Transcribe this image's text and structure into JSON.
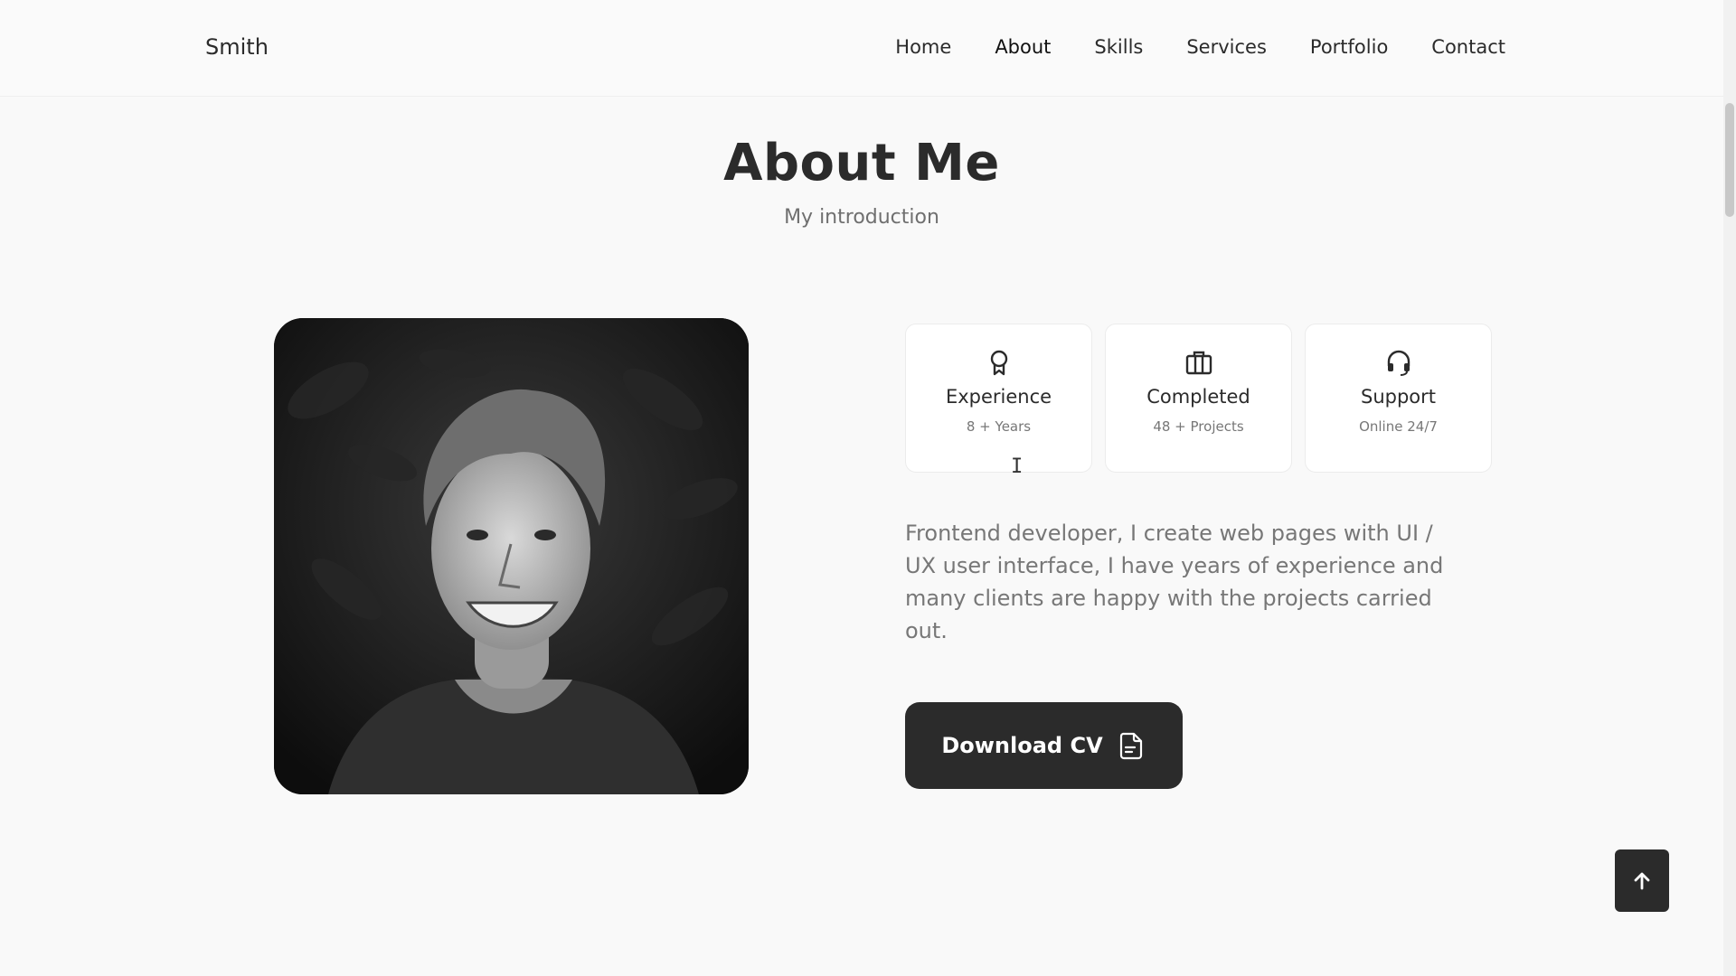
{
  "header": {
    "logo": "Smith",
    "nav": [
      "Home",
      "About",
      "Skills",
      "Services",
      "Portfolio",
      "Contact"
    ],
    "active_nav": "About"
  },
  "section": {
    "title": "About Me",
    "subtitle": "My introduction"
  },
  "cards": [
    {
      "icon": "award-icon",
      "title": "Experience",
      "subtitle": "8 + Years"
    },
    {
      "icon": "briefcase-icon",
      "title": "Completed",
      "subtitle": "48 + Projects"
    },
    {
      "icon": "headset-icon",
      "title": "Support",
      "subtitle": "Online 24/7"
    }
  ],
  "description": "Frontend developer, I create web pages with UI / UX user interface, I have years of experience and many clients are happy with the projects carried out.",
  "download_button": {
    "label": "Download CV",
    "icon": "document-icon"
  },
  "scroll_up_button": {
    "icon": "arrow-up-icon"
  },
  "colors": {
    "background": "#f9f9f9",
    "dark": "#2b2b2b",
    "muted": "#777777"
  }
}
